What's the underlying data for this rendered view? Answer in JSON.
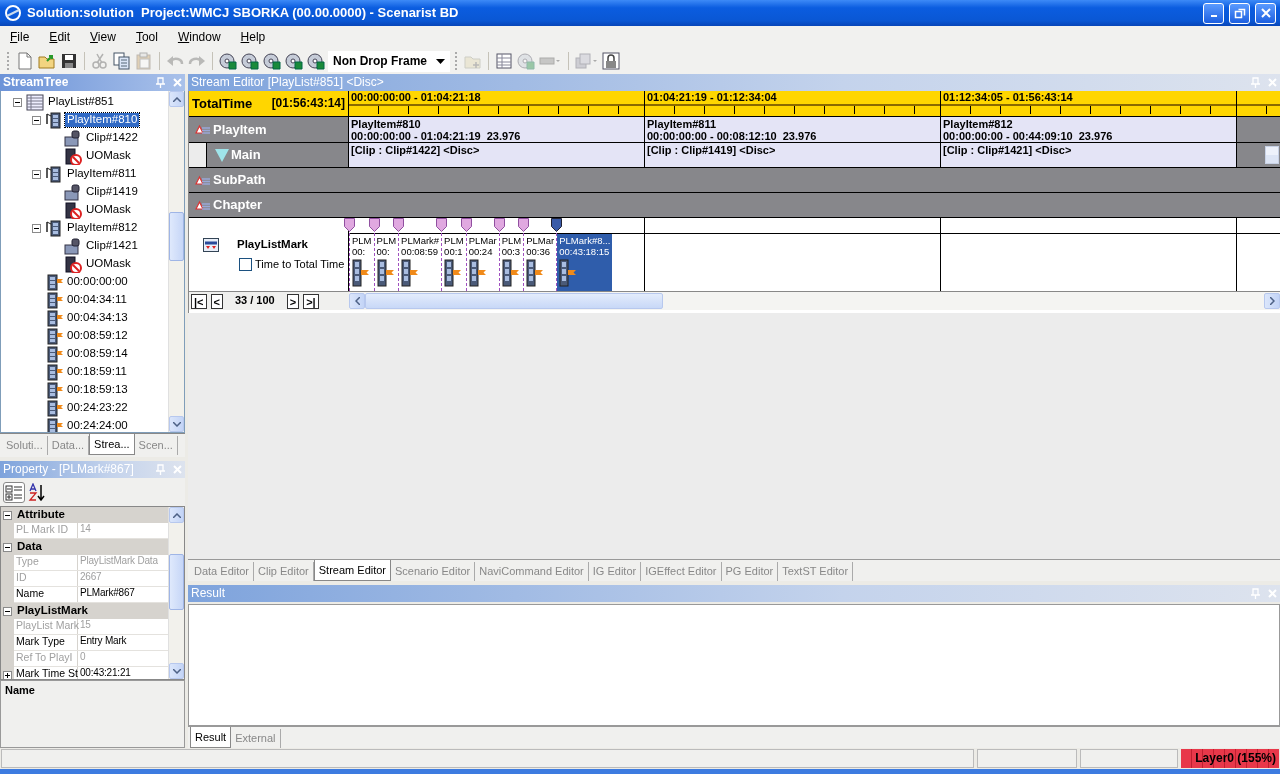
{
  "window": {
    "title": "Solution:solution  Project:WMCJ SBORKA (00.00.0000) - Scenarist BD"
  },
  "menu": [
    {
      "label": "File"
    },
    {
      "label": "Edit"
    },
    {
      "label": "View"
    },
    {
      "label": "Tool"
    },
    {
      "label": "Window"
    },
    {
      "label": "Help"
    }
  ],
  "toolbar": [
    [
      {
        "kind": "new",
        "disabled": false
      },
      {
        "kind": "open",
        "disabled": false
      },
      {
        "kind": "save",
        "disabled": false
      }
    ],
    [
      {
        "kind": "cut",
        "disabled": true
      },
      {
        "kind": "copy",
        "disabled": false
      },
      {
        "kind": "paste",
        "disabled": true
      }
    ],
    [
      {
        "kind": "undo",
        "disabled": true
      },
      {
        "kind": "redo",
        "disabled": true
      }
    ],
    [
      {
        "kind": "disc",
        "disabled": false
      },
      {
        "kind": "disc",
        "disabled": false
      },
      {
        "kind": "disc",
        "disabled": false
      },
      {
        "kind": "disc",
        "disabled": false
      },
      {
        "kind": "disc",
        "disabled": false
      }
    ]
  ],
  "timecode_mode": "Non Drop Frame",
  "toolbar_right": [
    [
      {
        "kind": "folder",
        "disabled": true
      }
    ],
    [
      {
        "kind": "table",
        "disabled": false
      },
      {
        "kind": "disc",
        "disabled": true
      },
      {
        "kind": "drive",
        "disabled": true
      }
    ],
    [
      {
        "kind": "stack",
        "disabled": true
      },
      {
        "kind": "lock",
        "disabled": false
      }
    ]
  ],
  "stream_tree": {
    "title": "StreamTree",
    "items": [
      {
        "kind": "playlist",
        "label": "PlayList#851",
        "selected": false,
        "expanded": true,
        "children": [
          {
            "kind": "playitem",
            "label": "PlayItem#810",
            "selected": true,
            "expanded": true,
            "children": [
              {
                "kind": "clip",
                "label": "Clip#1422",
                "selected": false
              },
              {
                "kind": "uomask",
                "label": "UOMask",
                "selected": false
              }
            ]
          },
          {
            "kind": "playitem",
            "label": "PlayItem#811",
            "selected": false,
            "expanded": true,
            "children": [
              {
                "kind": "clip",
                "label": "Clip#1419",
                "selected": false
              },
              {
                "kind": "uomask",
                "label": "UOMask",
                "selected": false
              }
            ]
          },
          {
            "kind": "playitem",
            "label": "PlayItem#812",
            "selected": false,
            "expanded": true,
            "children": [
              {
                "kind": "clip",
                "label": "Clip#1421",
                "selected": false
              },
              {
                "kind": "uomask",
                "label": "UOMask",
                "selected": false
              }
            ]
          },
          {
            "kind": "mark",
            "label": "00:00:00:00",
            "selected": false
          },
          {
            "kind": "mark",
            "label": "00:04:34:11",
            "selected": false
          },
          {
            "kind": "mark",
            "label": "00:04:34:13",
            "selected": false
          },
          {
            "kind": "mark",
            "label": "00:08:59:12",
            "selected": false
          },
          {
            "kind": "mark",
            "label": "00:08:59:14",
            "selected": false
          },
          {
            "kind": "mark",
            "label": "00:18:59:11",
            "selected": false
          },
          {
            "kind": "mark",
            "label": "00:18:59:13",
            "selected": false
          },
          {
            "kind": "mark",
            "label": "00:24:23:22",
            "selected": false
          },
          {
            "kind": "mark",
            "label": "00:24:24:00",
            "selected": false
          }
        ]
      }
    ]
  },
  "left_tabs": [
    {
      "label": "Soluti...",
      "selected": false
    },
    {
      "label": "Data...",
      "selected": false
    },
    {
      "label": "Strea...",
      "selected": true
    },
    {
      "label": "Scen...",
      "selected": false
    }
  ],
  "property": {
    "title": "Property - [PLMark#867]",
    "categories": [
      {
        "label": "Attribute",
        "expanded": true,
        "rows": [
          {
            "name": "PL Mark ID",
            "value": "14",
            "disabled": true,
            "expandable": false
          }
        ]
      },
      {
        "label": "Data",
        "expanded": true,
        "rows": [
          {
            "name": "Type",
            "value": "PlayListMark Data",
            "disabled": true,
            "expandable": false
          },
          {
            "name": "ID",
            "value": "2667",
            "disabled": true,
            "expandable": false
          },
          {
            "name": "Name",
            "value": "PLMark#867",
            "disabled": false,
            "expandable": false
          }
        ]
      },
      {
        "label": "PlayListMark",
        "expanded": true,
        "rows": [
          {
            "name": "PlayList Mark",
            "value": "15",
            "disabled": true,
            "expandable": false
          },
          {
            "name": "Mark Type",
            "value": "Entry Mark",
            "disabled": false,
            "expandable": false
          },
          {
            "name": "Ref To PlayI",
            "value": "0",
            "disabled": true,
            "expandable": false
          },
          {
            "name": "Mark Time St",
            "value": "00:43:21:21",
            "disabled": false,
            "expandable": true
          }
        ]
      }
    ],
    "description": "Name"
  },
  "stream_editor": {
    "title": "Stream Editor [PlayList#851] <Disc>",
    "total_label": "TotalTime",
    "total_time": "[01:56:43:14]",
    "tracks": [
      {
        "kind": "group",
        "label": "PlayItem"
      },
      {
        "kind": "sub",
        "label": "Main"
      },
      {
        "kind": "group",
        "label": "SubPath"
      },
      {
        "kind": "group",
        "label": "Chapter"
      }
    ],
    "segments": [
      {
        "range": "00:00:00:00 - 01:04:21:18",
        "playitem": "PlayItem#810",
        "playitem_time": "00:00:00:00 - 01:04:21:19  23.976",
        "clip": "[Clip : Clip#1422] <Disc>"
      },
      {
        "range": "01:04:21:19 - 01:12:34:04",
        "playitem": "PlayItem#811",
        "playitem_time": "00:00:00:00 - 00:08:12:10  23.976",
        "clip": "[Clip : Clip#1419] <Disc>"
      },
      {
        "range": "01:12:34:05 - 01:56:43:14",
        "playitem": "PlayItem#812",
        "playitem_time": "00:00:00:00 - 00:44:09:10  23.976",
        "clip": "[Clip : Clip#1421] <Disc>"
      }
    ],
    "mark_track": {
      "label": "PlayListMark",
      "checkbox": {
        "label": "Time to Total Time",
        "checked": false
      },
      "marks": [
        {
          "label": "PLM",
          "time": "00:",
          "selected": false
        },
        {
          "label": "PLM",
          "time": "00:",
          "selected": false
        },
        {
          "label": "PLMark#",
          "time": "00:08:59",
          "selected": false
        },
        {
          "label": "PLM",
          "time": "00:1",
          "selected": false
        },
        {
          "label": "PLMar",
          "time": "00:24",
          "selected": false
        },
        {
          "label": "PLM",
          "time": "00:3",
          "selected": false
        },
        {
          "label": "PLMar",
          "time": "00:36",
          "selected": false
        },
        {
          "label": "PLMark#8...",
          "time": "00:43:18:15",
          "selected": true
        }
      ]
    },
    "nav": {
      "first": "|<",
      "prev": "<",
      "page": "33 / 100",
      "next": ">",
      "last": ">|"
    }
  },
  "editor_tabs": [
    {
      "label": "Data Editor",
      "selected": false
    },
    {
      "label": "Clip Editor",
      "selected": false
    },
    {
      "label": "Stream Editor",
      "selected": true
    },
    {
      "label": "Scenario Editor",
      "selected": false
    },
    {
      "label": "NaviCommand Editor",
      "selected": false
    },
    {
      "label": "IG Editor",
      "selected": false
    },
    {
      "label": "IGEffect Editor",
      "selected": false
    },
    {
      "label": "PG Editor",
      "selected": false
    },
    {
      "label": "TextST Editor",
      "selected": false
    }
  ],
  "result": {
    "title": "Result"
  },
  "result_tabs": [
    {
      "label": "Result",
      "selected": true
    },
    {
      "label": "External",
      "selected": false
    }
  ],
  "status_bar": {
    "layer": "Layer0 (155%)"
  }
}
